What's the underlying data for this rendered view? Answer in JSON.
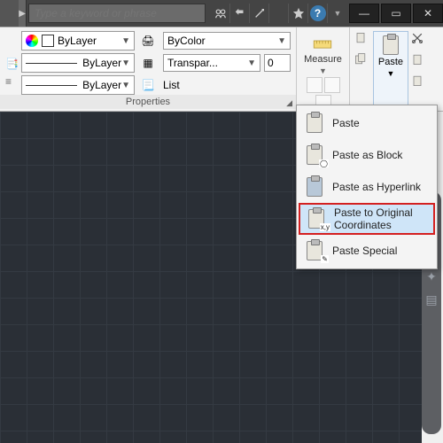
{
  "titlebar": {
    "search_placeholder": "Type a keyword or phrase",
    "help_label": "?",
    "min_label": "—",
    "max_label": "▭",
    "close_label": "✕"
  },
  "properties": {
    "title": "Properties",
    "color_combo": "ByLayer",
    "linetype_combo": "ByLayer",
    "lineweight_combo": "ByLayer",
    "plot_combo": "ByColor",
    "transparency_placeholder": "Transpar...",
    "transparency_value": "0",
    "list_label": "List"
  },
  "utilities": {
    "measure_label": "Measure"
  },
  "clipboard": {
    "paste_label": "Paste"
  },
  "paste_menu": {
    "items": [
      {
        "label": "Paste",
        "icon": "paste"
      },
      {
        "label": "Paste as Block",
        "icon": "paste-block"
      },
      {
        "label": "Paste as Hyperlink",
        "icon": "paste-link"
      },
      {
        "label": "Paste to Original Coordinates",
        "icon": "paste-xy",
        "highlight": true
      },
      {
        "label": "Paste Special",
        "icon": "paste-special"
      }
    ]
  }
}
